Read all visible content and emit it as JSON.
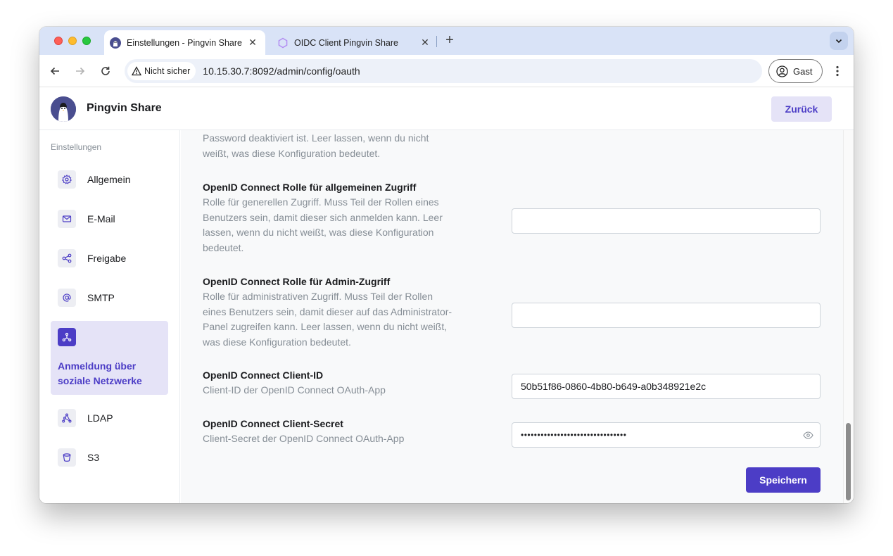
{
  "browser": {
    "tabs": [
      {
        "title": "Einstellungen - Pingvin Share",
        "active": true
      },
      {
        "title": "OIDC Client Pingvin Share",
        "active": false
      }
    ],
    "security_label": "Nicht sicher",
    "url": "10.15.30.7:8092/admin/config/oauth",
    "profile_label": "Gast"
  },
  "app": {
    "name": "Pingvin Share",
    "back_label": "Zurück"
  },
  "sidebar": {
    "heading": "Einstellungen",
    "items": [
      {
        "label": "Allgemein",
        "icon": "gear-icon"
      },
      {
        "label": "E-Mail",
        "icon": "mail-icon"
      },
      {
        "label": "Freigabe",
        "icon": "share-icon"
      },
      {
        "label": "SMTP",
        "icon": "at-icon"
      },
      {
        "label": "Anmeldung über soziale Netzwerke",
        "icon": "network-icon",
        "active": true
      },
      {
        "label": "LDAP",
        "icon": "ldap-icon"
      },
      {
        "label": "S3",
        "icon": "bucket-icon"
      }
    ]
  },
  "settings": {
    "top_desc": "Password deaktiviert ist. Leer lassen, wenn du nicht weißt, was diese Konfiguration bedeutet.",
    "fields": [
      {
        "label": "OpenID Connect Rolle für allgemeinen Zugriff",
        "desc": "Rolle für generellen Zugriff. Muss Teil der Rollen eines Benutzers sein, damit dieser sich anmelden kann. Leer lassen, wenn du nicht weißt, was diese Konfiguration bedeutet.",
        "value": ""
      },
      {
        "label": "OpenID Connect Rolle für Admin-Zugriff",
        "desc": "Rolle für administrativen Zugriff. Muss Teil der Rollen eines Benutzers sein, damit dieser auf das Administrator-Panel zugreifen kann. Leer lassen, wenn du nicht weißt, was diese Konfiguration bedeutet.",
        "value": ""
      },
      {
        "label": "OpenID Connect Client-ID",
        "desc": "Client-ID der OpenID Connect OAuth-App",
        "value": "50b51f86-0860-4b80-b649-a0b348921e2c"
      },
      {
        "label": "OpenID Connect Client-Secret",
        "desc": "Client-Secret der OpenID Connect OAuth-App",
        "value": "••••••••••••••••••••••••••••••••"
      }
    ],
    "save_label": "Speichern"
  }
}
